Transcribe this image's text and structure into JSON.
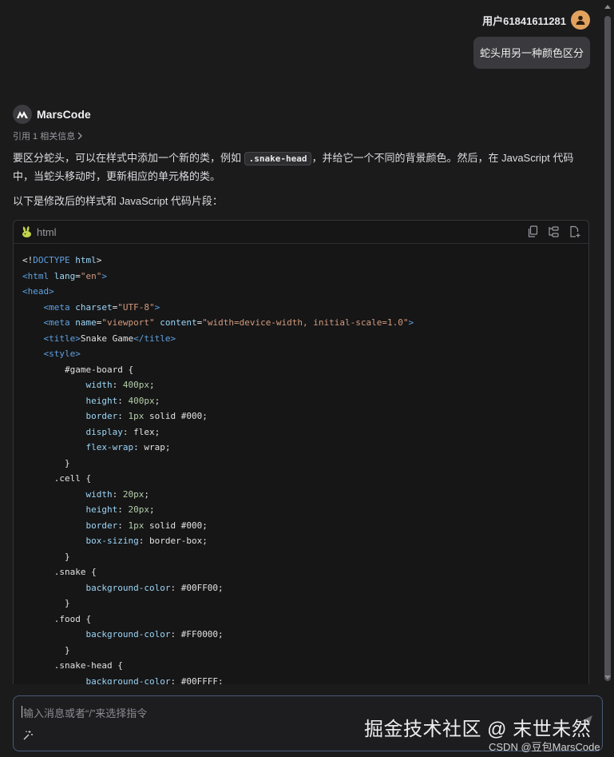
{
  "user": {
    "name": "用户61841611281",
    "message": "蛇头用另一种颜色区分"
  },
  "assistant": {
    "name": "MarsCode",
    "reference": "引用 1 相关信息",
    "para1_before": "要区分蛇头，可以在样式中添加一个新的类，例如 ",
    "para1_code": ".snake-head",
    "para1_after": "，并给它一个不同的背景颜色。然后，在 JavaScript 代码中，当蛇头移动时，更新相应的单元格的类。",
    "para2": "以下是修改后的样式和 JavaScript 代码片段："
  },
  "code_block": {
    "language": "html",
    "actions": [
      "copy-icon",
      "diff-icon",
      "insert-file-icon"
    ]
  },
  "input": {
    "placeholder": "输入消息或者“/”来选择指令"
  },
  "watermark": {
    "main": "掘金技术社区 @ 末世未然",
    "sub": "CSDN @豆包MarsCode"
  },
  "colors": {
    "background": "#1b1b1c",
    "user_avatar": "#e2a25e",
    "input_border": "#4b5a78"
  }
}
